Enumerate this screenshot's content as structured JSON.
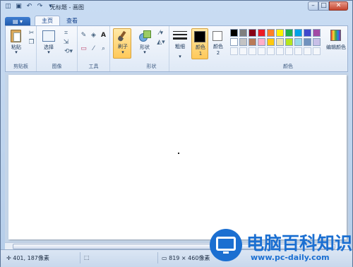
{
  "window": {
    "title": "无标题 - 画图"
  },
  "qat": {
    "icons": [
      "paint-app-icon",
      "save-icon",
      "undo-icon",
      "redo-icon",
      "customize-dropdown-icon"
    ]
  },
  "winbtns": {
    "minimize": "–",
    "maximize": "□",
    "close": "✕"
  },
  "tabs": {
    "app_menu": "▤ ▾",
    "home": "主页",
    "view": "查看"
  },
  "ribbon": {
    "clipboard": {
      "label": "剪贴板",
      "paste": "粘贴"
    },
    "image": {
      "label": "图像",
      "select": "选择"
    },
    "tools": {
      "label": "工具"
    },
    "brushes": {
      "label": "刷子"
    },
    "shapes": {
      "label": "形状",
      "shapes_button": "形状"
    },
    "size": {
      "label": "粗细"
    },
    "color1": {
      "label": "颜色 1"
    },
    "color2": {
      "label": "颜色 2"
    },
    "colors": {
      "label": "颜色",
      "edit": "编辑颜色"
    },
    "color1_value": "#000000",
    "color2_value": "#ffffff",
    "palette_row1": [
      "#000000",
      "#7f7f7f",
      "#880015",
      "#ed1c24",
      "#ff7f27",
      "#fff200",
      "#22b14c",
      "#00a2e8",
      "#3f48cc",
      "#a349a4"
    ],
    "palette_row2": [
      "#ffffff",
      "#c3c3c3",
      "#b97a57",
      "#ffaec9",
      "#ffc90e",
      "#efe4b0",
      "#b5e61d",
      "#99d9ea",
      "#7092be",
      "#c8bfe7"
    ]
  },
  "status": {
    "cursor_pos": "401, 187像素",
    "canvas_size": "819 × 460像素"
  },
  "watermark": {
    "name": "电脑百科知识",
    "url": "www.pc-daily.com"
  }
}
